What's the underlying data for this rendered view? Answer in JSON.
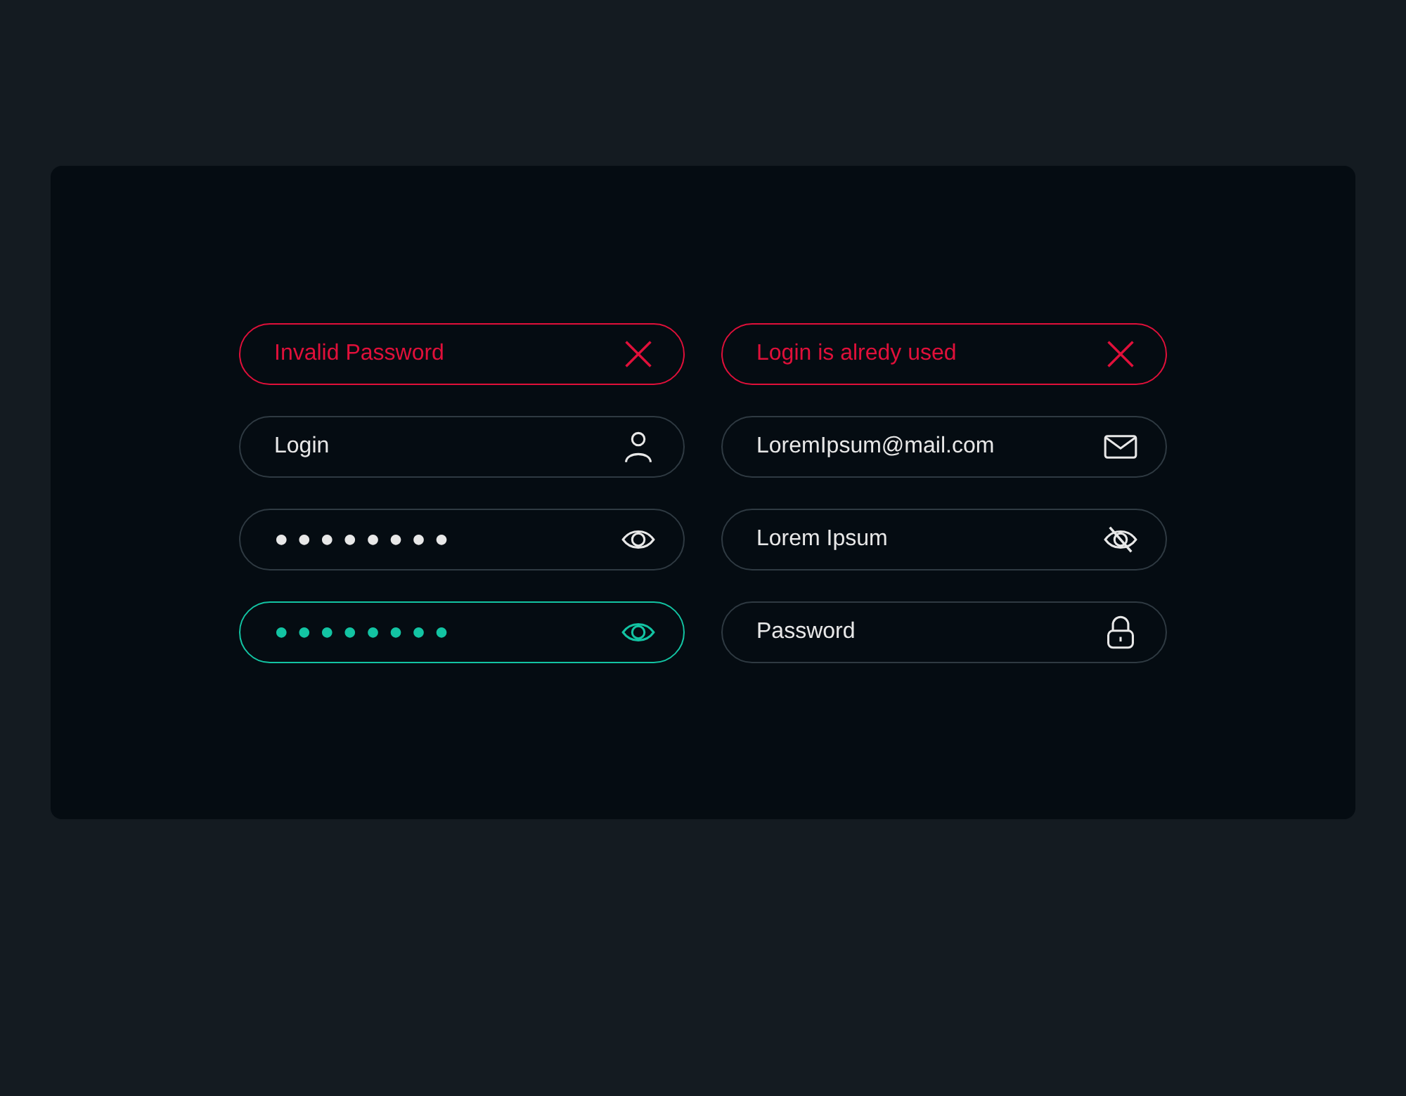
{
  "fields": [
    {
      "kind": "error",
      "text": "Invalid Password"
    },
    {
      "kind": "error",
      "text": "Login is alredy used"
    },
    {
      "kind": "user",
      "text": "Login",
      "focused": false
    },
    {
      "kind": "email",
      "text": "LoremIpsum@mail.com",
      "focused": false
    },
    {
      "kind": "password",
      "text": "●●●●●●●●",
      "focused": false
    },
    {
      "kind": "hidden",
      "text": "Lorem Ipsum",
      "focused": false
    },
    {
      "kind": "password",
      "text": "●●●●●●●●",
      "focused": true
    },
    {
      "kind": "lock",
      "text": "Password",
      "focused": false
    }
  ]
}
